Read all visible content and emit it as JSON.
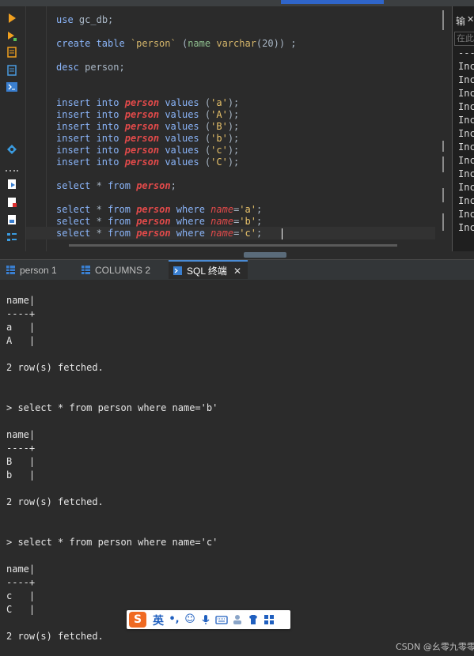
{
  "editor": {
    "lines": [
      "use gc_db;",
      "create table `person` (name varchar(20)) ;",
      "desc person;",
      "insert into person values ('a');",
      "insert into person values ('A');",
      "insert into person values ('B');",
      "insert into person values ('b');",
      "insert into person values ('c');",
      "insert into person values ('C');",
      "select * from person;",
      "select * from person where name='a';",
      "select * from person where name='b';",
      "select * from person where name='c';"
    ]
  },
  "right_panel": {
    "title": "输",
    "filter_placeholder": "在此",
    "rows": [
      "---",
      "Inc",
      "Inc",
      "Inc",
      "Inc",
      "Inc",
      "Inc",
      "Inc",
      "Inc",
      "Inc",
      "Inc",
      "Inc",
      "Inc",
      "Inc"
    ]
  },
  "tabs": [
    {
      "label": "person 1",
      "active": false
    },
    {
      "label": "COLUMNS 2",
      "active": false
    },
    {
      "label": "SQL 终端",
      "active": true
    }
  ],
  "console": {
    "block1": {
      "header": "name|",
      "sep": "----+",
      "rows": [
        "a   |",
        "A   |"
      ],
      "footer": "2 row(s) fetched."
    },
    "query2": "> select * from person where name='b'",
    "block2": {
      "header": "name|",
      "sep": "----+",
      "rows": [
        "B   |",
        "b   |"
      ],
      "footer": "2 row(s) fetched."
    },
    "query3": "> select * from person where name='c'",
    "block3": {
      "header": "name|",
      "sep": "----+",
      "rows": [
        "c   |",
        "C   |"
      ],
      "footer": "2 row(s) fetched."
    }
  },
  "ime": {
    "logo": "S",
    "lang": "英",
    "punct": "•,"
  },
  "watermark": "CSDN @幺零九零零"
}
